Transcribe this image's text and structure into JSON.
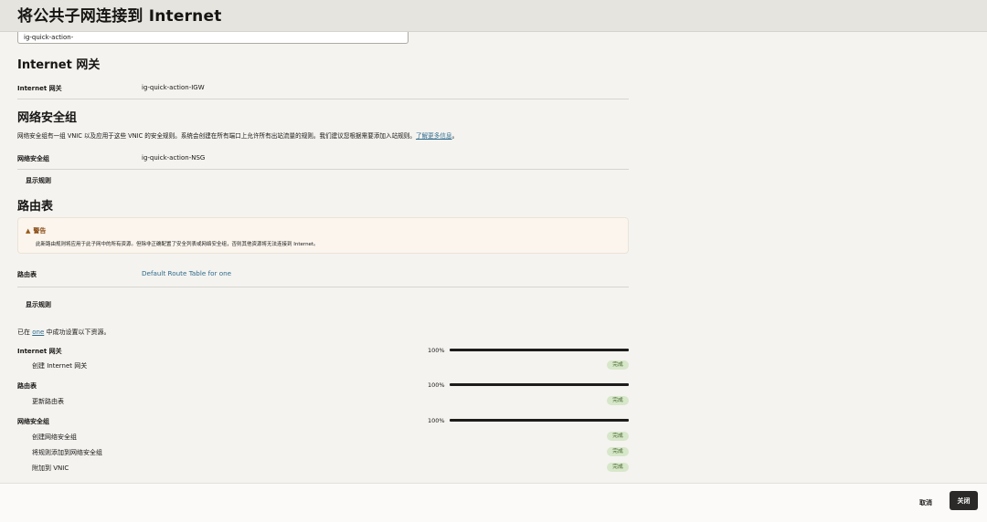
{
  "header": {
    "title": "将公共子网连接到 Internet"
  },
  "top_field": {
    "value": "ig-quick-action-"
  },
  "internet_gateway": {
    "heading": "Internet 网关",
    "label": "Internet 网关",
    "value": "ig-quick-action-IGW"
  },
  "nsg": {
    "heading": "网络安全组",
    "description": "网络安全组有一组 VNIC 以及应用于这些 VNIC 的安全规则。系统会创建在所有端口上允许所有出站流量的规则。我们建议您根据需要添加入站规则。",
    "learn_more": "了解更多信息",
    "description_end": "。",
    "label": "网络安全组",
    "value": "ig-quick-action-NSG",
    "show_rules": "显示规则"
  },
  "route_table": {
    "heading": "路由表",
    "warning_title": "警告",
    "warning_text": "此新路由规则将应用于此子网中的所有资源。但除非正确配置了安全列表或网络安全组，否则其他资源将无法连接到 Internet。",
    "label": "路由表",
    "value": "Default Route Table for one",
    "show_rules": "显示规则"
  },
  "status": {
    "prefix": "已在 ",
    "link": "one",
    "suffix": " 中成功设置以下资源。",
    "sections": [
      {
        "label": "Internet 网关",
        "percent": "100%",
        "progress": 1.0,
        "tasks": [
          {
            "name": "创建 Internet 网关",
            "badge": "完成"
          }
        ]
      },
      {
        "label": "路由表",
        "percent": "100%",
        "progress": 1.0,
        "tasks": [
          {
            "name": "更新路由表",
            "badge": "完成"
          }
        ]
      },
      {
        "label": "网络安全组",
        "percent": "100%",
        "progress": 1.0,
        "tasks": [
          {
            "name": "创建网络安全组",
            "badge": "完成"
          },
          {
            "name": "将规则添加到网络安全组",
            "badge": "完成"
          },
          {
            "name": "附加到 VNIC",
            "badge": "完成"
          }
        ]
      }
    ]
  },
  "footer": {
    "cancel_label": "取消",
    "close_label": "关闭"
  }
}
